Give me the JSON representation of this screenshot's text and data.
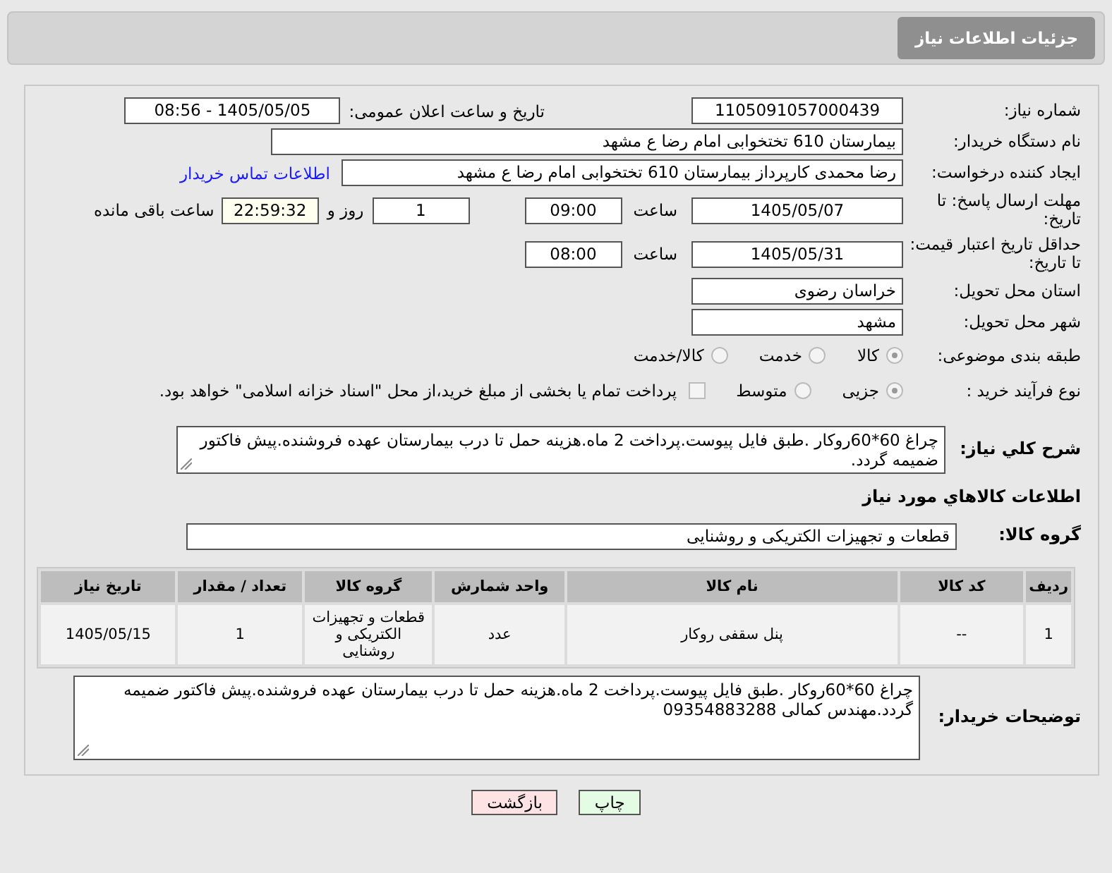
{
  "page_title": "جزئیات اطلاعات نیاز",
  "need_number": {
    "label": "شماره نیاز:",
    "value": "1105091057000439"
  },
  "announce": {
    "label": "تاریخ و ساعت اعلان عمومی:",
    "value": "1405/05/05 - 08:56"
  },
  "buyer_org": {
    "label": "نام دستگاه خریدار:",
    "value": "بیمارستان 610 تختخوابی امام رضا ع  مشهد"
  },
  "requester": {
    "label": "ایجاد کننده درخواست:",
    "value": "رضا محمدی کارپرداز بیمارستان 610 تختخوابی امام رضا ع  مشهد",
    "link": "اطلاعات تماس خریدار"
  },
  "deadline": {
    "label": "مهلت ارسال پاسخ: تا تاریخ:",
    "date": "1405/05/07",
    "time_label": "ساعت",
    "time": "09:00",
    "days": "1",
    "days_label": "روز و",
    "remaining": "22:59:32",
    "remaining_label": "ساعت باقی مانده"
  },
  "validity": {
    "label": "حداقل تاریخ اعتبار قیمت: تا تاریخ:",
    "date": "1405/05/31",
    "time_label": "ساعت",
    "time": "08:00"
  },
  "province": {
    "label": "استان محل تحویل:",
    "value": "خراسان رضوی"
  },
  "city": {
    "label": "شهر محل تحویل:",
    "value": "مشهد"
  },
  "category": {
    "label": "طبقه بندی موضوعی:",
    "options": [
      {
        "label": "کالا",
        "selected": true
      },
      {
        "label": "خدمت",
        "selected": false
      },
      {
        "label": "کالا/خدمت",
        "selected": false
      }
    ]
  },
  "process": {
    "label": "نوع فرآیند خرید :",
    "options": [
      {
        "label": "جزیی",
        "selected": true
      },
      {
        "label": "متوسط",
        "selected": false
      }
    ],
    "treasury": {
      "label": "پرداخت تمام یا بخشی از مبلغ خرید،از محل \"اسناد خزانه اسلامی\" خواهد بود.",
      "checked": false
    }
  },
  "description": {
    "label": "شرح کلي نیاز:",
    "value": "چراغ 60*60روکار .طبق فایل پیوست.پرداخت 2 ماه.هزینه حمل تا درب بیمارستان عهده فروشنده.پیش فاکتور ضمیمه گردد."
  },
  "goods_title": "اطلاعات کالاهاي مورد نیاز",
  "goods_group": {
    "label": "گروه کالا:",
    "value": "قطعات و تجهیزات الکتریکی و روشنایی"
  },
  "table": {
    "columns": [
      "ردیف",
      "کد کالا",
      "نام کالا",
      "واحد شمارش",
      "گروه کالا",
      "تعداد / مقدار",
      "تاریخ نیاز"
    ],
    "rows": [
      [
        "1",
        "--",
        "پنل سقفی روکار",
        "عدد",
        "قطعات و تجهیزات الکتریکی و روشنایی",
        "1",
        "1405/05/15"
      ]
    ]
  },
  "buyer_notes": {
    "label": "توضیحات خریدار:",
    "value": "چراغ 60*60روکار .طبق فایل پیوست.پرداخت 2 ماه.هزینه حمل تا درب بیمارستان عهده فروشنده.پیش فاکتور ضمیمه گردد.مهندس کمالی 09354883288"
  },
  "buttons": [
    {
      "label": "چاپ",
      "kind": "print"
    },
    {
      "label": "بازگشت",
      "kind": "back"
    }
  ]
}
